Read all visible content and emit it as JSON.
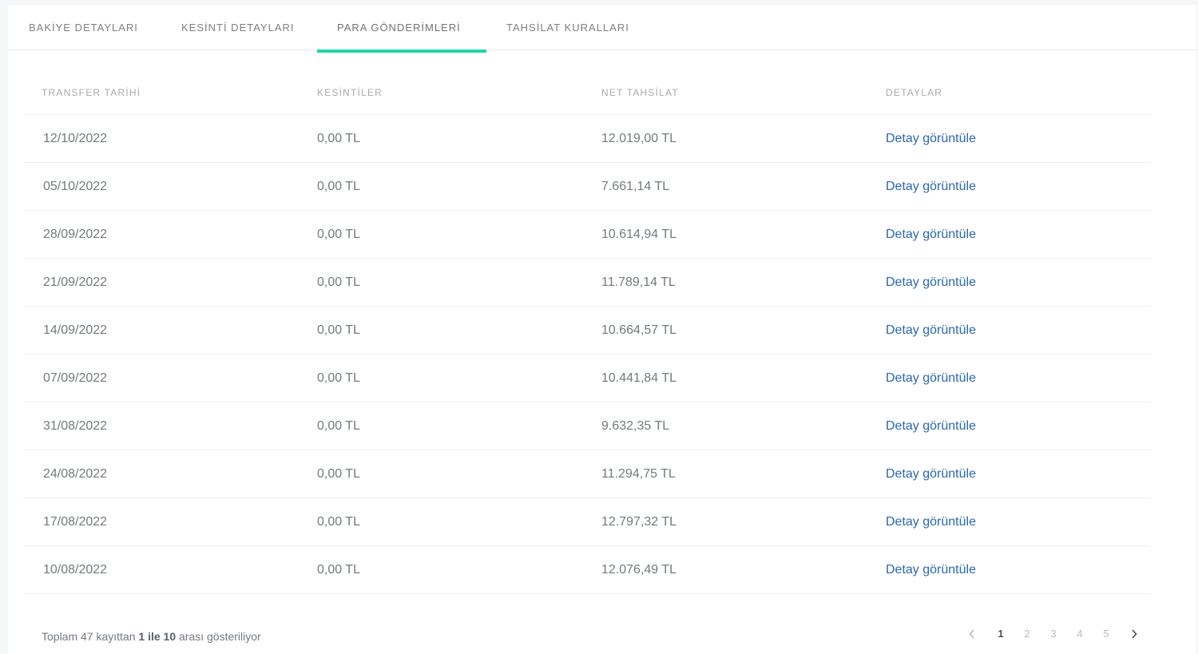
{
  "tabs": [
    {
      "label": "BAKİYE DETAYLARI",
      "active": false
    },
    {
      "label": "KESİNTİ DETAYLARI",
      "active": false
    },
    {
      "label": "PARA GÖNDERİMLERİ",
      "active": true
    },
    {
      "label": "TAHSİLAT KURALLARI",
      "active": false
    }
  ],
  "accent_color": "#1fd6a7",
  "link_color": "#2c67b0",
  "table": {
    "headers": [
      "TRANSFER TARİHİ",
      "KESİNTİLER",
      "NET TAHSİLAT",
      "DETAYLAR"
    ],
    "rows": [
      {
        "date": "12/10/2022",
        "deductions": "0,00 TL",
        "net": "12.019,00 TL",
        "details": "Detay görüntüle"
      },
      {
        "date": "05/10/2022",
        "deductions": "0,00 TL",
        "net": "7.661,14 TL",
        "details": "Detay görüntüle"
      },
      {
        "date": "28/09/2022",
        "deductions": "0,00 TL",
        "net": "10.614,94 TL",
        "details": "Detay görüntüle"
      },
      {
        "date": "21/09/2022",
        "deductions": "0,00 TL",
        "net": "11.789,14 TL",
        "details": "Detay görüntüle"
      },
      {
        "date": "14/09/2022",
        "deductions": "0,00 TL",
        "net": "10.664,57 TL",
        "details": "Detay görüntüle"
      },
      {
        "date": "07/09/2022",
        "deductions": "0,00 TL",
        "net": "10.441,84 TL",
        "details": "Detay görüntüle"
      },
      {
        "date": "31/08/2022",
        "deductions": "0,00 TL",
        "net": "9.632,35 TL",
        "details": "Detay görüntüle"
      },
      {
        "date": "24/08/2022",
        "deductions": "0,00 TL",
        "net": "11.294,75 TL",
        "details": "Detay görüntüle"
      },
      {
        "date": "17/08/2022",
        "deductions": "0,00 TL",
        "net": "12.797,32 TL",
        "details": "Detay görüntüle"
      },
      {
        "date": "10/08/2022",
        "deductions": "0,00 TL",
        "net": "12.076,49 TL",
        "details": "Detay görüntüle"
      }
    ]
  },
  "footer": {
    "prefix": "Toplam 47 kayıttan ",
    "range": "1 ile 10",
    "suffix": " arası gösteriliyor"
  },
  "pagination": {
    "prev_icon": "chevron-left-icon",
    "next_icon": "chevron-right-icon",
    "pages": [
      "1",
      "2",
      "3",
      "4",
      "5"
    ],
    "current": "1"
  }
}
